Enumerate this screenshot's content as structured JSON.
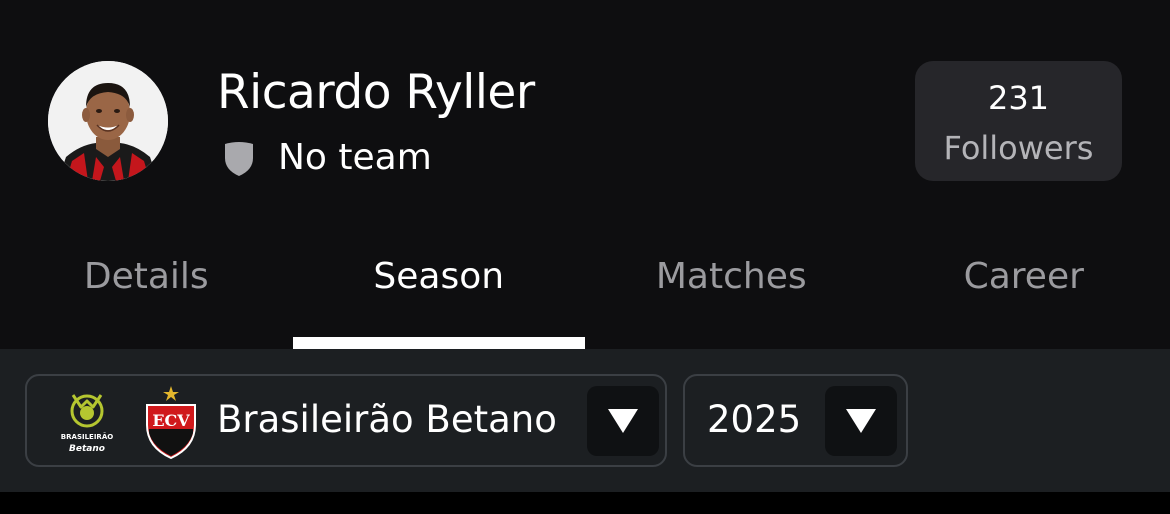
{
  "player": {
    "name": "Ricardo Ryller",
    "team": "No team",
    "avatar_icon": "player-photo",
    "team_icon": "shield-icon"
  },
  "followers": {
    "count": "231",
    "label": "Followers"
  },
  "tabs": [
    {
      "label": "Details",
      "active": false
    },
    {
      "label": "Season",
      "active": true
    },
    {
      "label": "Matches",
      "active": false
    },
    {
      "label": "Career",
      "active": false
    }
  ],
  "filters": {
    "competition": {
      "label": "Brasileirão Betano",
      "league_logo_text": [
        "BRASILEIRÃO",
        "Betano"
      ],
      "club_crest_text": "ECV"
    },
    "season": {
      "label": "2025"
    }
  },
  "colors": {
    "background": "#0e0e10",
    "card": "#26262a",
    "filter_bar": "#1c1f22",
    "league_green": "#b5c630",
    "club_red": "#d0191c"
  }
}
